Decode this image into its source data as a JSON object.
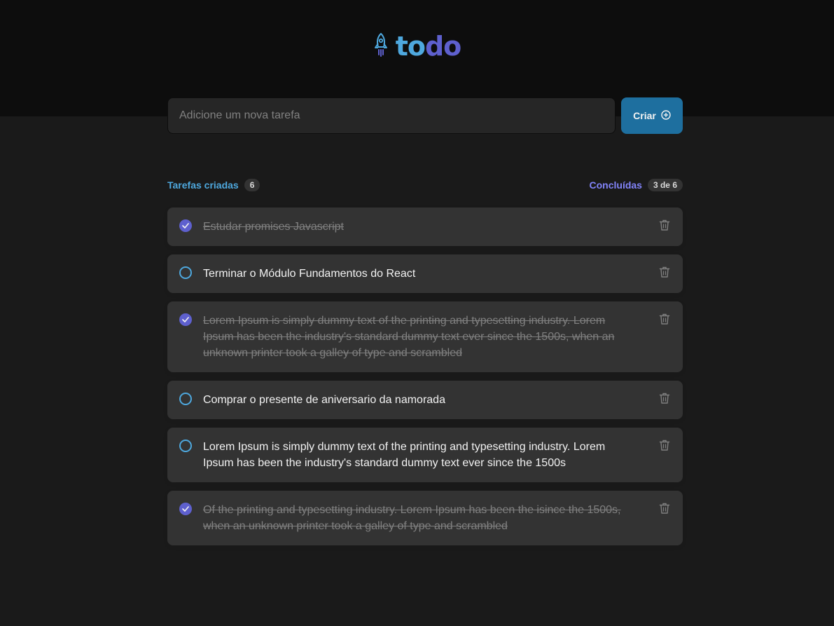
{
  "logo": {
    "part1": "to",
    "part2": "do",
    "icon": "rocket-icon"
  },
  "new_task": {
    "placeholder": "Adicione um nova tarefa",
    "button_label": "Criar",
    "button_icon": "plus-circle-icon"
  },
  "counters": {
    "created_label": "Tarefas criadas",
    "created_count": "6",
    "done_label": "Concluídas",
    "done_count": "3 de 6"
  },
  "colors": {
    "blue": "#4ea8de",
    "purple": "#5e60ce",
    "purple_light": "#8284fa",
    "button": "#1e6f9f"
  },
  "tasks": [
    {
      "text": "Estudar promises Javascript",
      "done": true
    },
    {
      "text": "Terminar o Módulo Fundamentos do React",
      "done": false
    },
    {
      "text": "Lorem Ipsum is simply dummy text of the printing and typesetting industry. Lorem Ipsum has been the industry's standard dummy text ever since the 1500s, when an unknown printer took a galley of type and scrambled",
      "done": true
    },
    {
      "text": "Comprar o presente de aniversario da namorada",
      "done": false
    },
    {
      "text": "Lorem Ipsum is simply dummy text of the printing and typesetting industry. Lorem Ipsum has been the industry's standard dummy text ever since the 1500s",
      "done": false
    },
    {
      "text": "Of the printing and typesetting industry. Lorem Ipsum has been the isince the 1500s, when an unknown printer took a galley of type and scrambled",
      "done": true
    }
  ]
}
